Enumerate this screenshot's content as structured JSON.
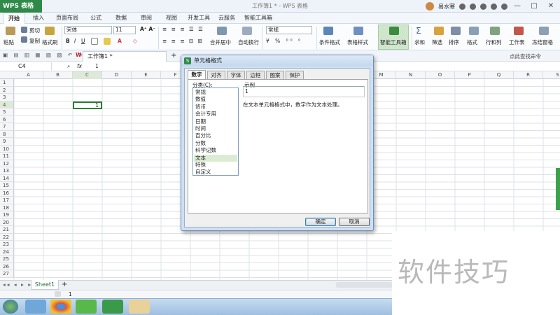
{
  "titlebar": {
    "app_badge": "WPS 表格",
    "doc_title": "工作簿1 * - WPS 表格",
    "user": "易水寒"
  },
  "ribbon_tabs": [
    "开始",
    "插入",
    "页面布局",
    "公式",
    "数据",
    "审阅",
    "视图",
    "开发工具",
    "云服务",
    "智能工具箱"
  ],
  "ribbon": {
    "paste": "粘贴",
    "cut": "剪切",
    "copy": "复制",
    "format_painter": "格式刷",
    "font": "宋体",
    "font_size": "11",
    "merge_center": "合并居中",
    "auto_wrap": "自动换行",
    "number_format": "常规",
    "conditional_format": "条件格式",
    "table_style": "表格样式",
    "smart_toolbox": "智能工具箱",
    "sum": "求和",
    "filter": "筛选",
    "sort": "排序",
    "format": "格式",
    "rows_cols": "行和列",
    "worksheet": "工作表",
    "freeze": "冻结窗格"
  },
  "qat": {
    "doc_tab": "工作簿1 *",
    "remote_office": "点此查找命令"
  },
  "formula_bar": {
    "namebox": "C4",
    "fx": "fx",
    "value": "1"
  },
  "columns": [
    "A",
    "B",
    "C",
    "D",
    "E",
    "F",
    "G",
    "H",
    "I",
    "J",
    "K",
    "L",
    "M",
    "N",
    "O",
    "P",
    "Q",
    "R",
    "S"
  ],
  "rows": [
    "1",
    "2",
    "3",
    "4",
    "5",
    "6",
    "7",
    "8",
    "9",
    "10",
    "11",
    "12",
    "13",
    "14",
    "15",
    "16",
    "17",
    "18",
    "19",
    "20",
    "21",
    "22",
    "23",
    "24",
    "25",
    "26",
    "27"
  ],
  "cell_c4": "1",
  "sheet_tab": "Sheet1",
  "status": {
    "value": "1"
  },
  "watermark": "软件技巧",
  "dialog": {
    "title": "单元格格式",
    "tabs": [
      "数字",
      "对齐",
      "字体",
      "边框",
      "图案",
      "保护"
    ],
    "category_label": "分类(C):",
    "categories": [
      "常规",
      "数值",
      "货币",
      "会计专用",
      "日期",
      "时间",
      "百分比",
      "分数",
      "科学记数",
      "文本",
      "特殊",
      "自定义"
    ],
    "selected_category": "文本",
    "sample_label": "示例",
    "sample_value": "1",
    "description": "在文本单元格格式中，数字作为文本处理。",
    "ok": "确定",
    "cancel": "取消"
  },
  "colors": {
    "brand": "#2f8a4a",
    "selected_category": "#dcecd2",
    "selected_cell_border": "#2e7d32"
  }
}
